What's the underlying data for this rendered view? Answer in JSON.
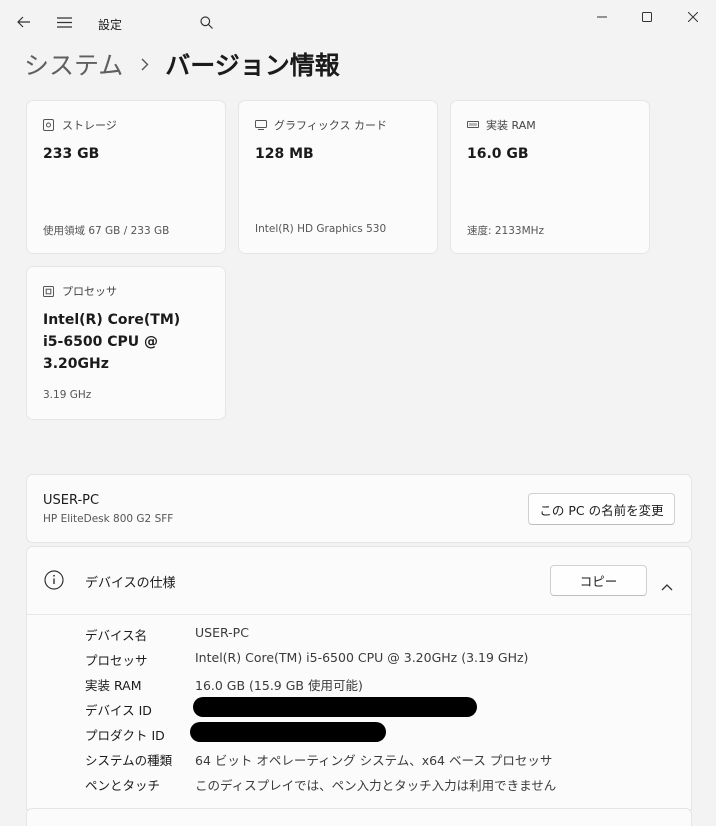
{
  "titlebar": {
    "title": "設定"
  },
  "breadcrumb": {
    "parent": "システム",
    "current": "バージョン情報"
  },
  "cards": {
    "storage": {
      "label": "ストレージ",
      "value": "233 GB",
      "sub": "使用領域 67 GB / 233 GB"
    },
    "graphics": {
      "label": "グラフィックス カード",
      "value": "128 MB",
      "sub": "Intel(R) HD Graphics 530"
    },
    "ram": {
      "label": "実装 RAM",
      "value": "16.0 GB",
      "sub": "速度: 2133MHz"
    },
    "processor": {
      "label": "プロセッサ",
      "value_lines": [
        "Intel(R) Core(TM)",
        "i5-6500 CPU @",
        "3.20GHz"
      ],
      "sub": "3.19 GHz"
    }
  },
  "pc": {
    "name": "USER-PC",
    "model": "HP EliteDesk 800 G2 SFF",
    "rename_label": "この PC の名前を変更"
  },
  "specs": {
    "title": "デバイスの仕様",
    "copy_label": "コピー",
    "rows": [
      {
        "label": "デバイス名",
        "value": "USER-PC"
      },
      {
        "label": "プロセッサ",
        "value": "Intel(R) Core(TM) i5-6500 CPU @ 3.20GHz (3.19 GHz)"
      },
      {
        "label": "実装 RAM",
        "value": "16.0 GB (15.9 GB 使用可能)"
      },
      {
        "label": "デバイス ID",
        "value": ""
      },
      {
        "label": "プロダクト ID",
        "value": ""
      },
      {
        "label": "システムの種類",
        "value": "64 ビット オペレーティング システム、x64 ベース プロセッサ"
      },
      {
        "label": "ペンとタッチ",
        "value": "このディスプレイでは、ペン入力とタッチ入力は利用できません"
      }
    ]
  },
  "colors": {
    "background": "#f3f3f3",
    "card": "#fbfbfb",
    "border": "#e5e5e5",
    "text": "#1b1b1b",
    "secondary": "#5f5f5f"
  }
}
